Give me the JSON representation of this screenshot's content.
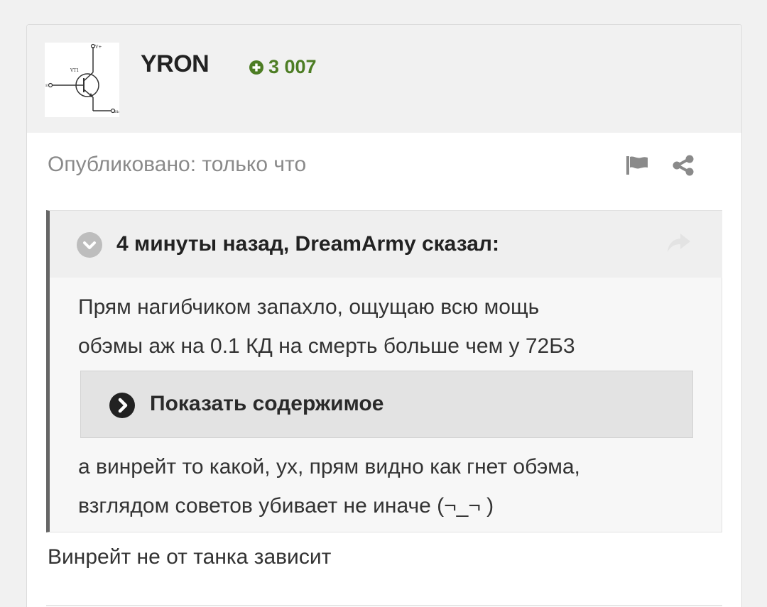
{
  "author": {
    "name": "YRON",
    "reputation": "3 007"
  },
  "post": {
    "meta": "Опубликовано: только что",
    "reply": "Винрейт не от танка зависит"
  },
  "quote": {
    "citation": "4 минуты назад, DreamArmy сказал:",
    "body1_line1": "Прям нагибчиком запахло, ощущаю всю мощь",
    "body1_line2": "обэмы аж на 0.1 КД на смерть больше чем у 72Б3",
    "spoiler_label": "Показать содержимое",
    "body2_line1": "а винрейт то какой, ух, прям видно как гнет обэма,",
    "body2_line2": "взглядом советов убивает не иначе (¬_¬ )"
  },
  "colors": {
    "reputation": "#4d7d24",
    "quote_border": "#666666"
  },
  "icons": {
    "reputation": "plus-circle-icon",
    "report": "flag-icon",
    "share": "share-icon",
    "quote_toggle": "chevron-down-icon",
    "quote_link": "share-arrow-icon",
    "spoiler": "chevron-right-icon"
  }
}
